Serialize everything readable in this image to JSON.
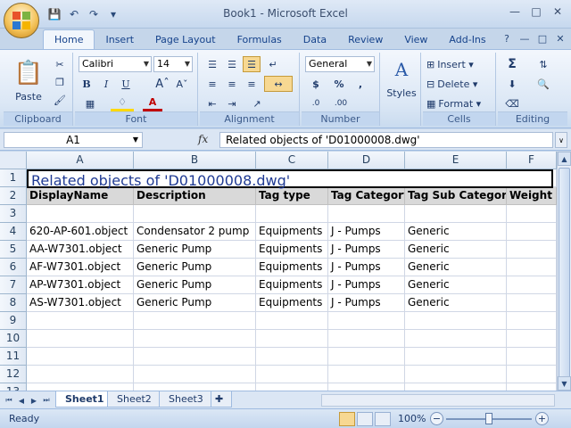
{
  "window": {
    "title": "Book1 - Microsoft Excel"
  },
  "ribbon": {
    "tabs": [
      "Home",
      "Insert",
      "Page Layout",
      "Formulas",
      "Data",
      "Review",
      "View",
      "Add-Ins"
    ],
    "active_tab": "Home",
    "clipboard": {
      "label": "Clipboard",
      "paste_label": "Paste"
    },
    "font": {
      "label": "Font",
      "family": "Calibri",
      "size": "14"
    },
    "alignment": {
      "label": "Alignment"
    },
    "number": {
      "label": "Number",
      "format": "General"
    },
    "styles": {
      "label": "Styles"
    },
    "cells": {
      "label": "Cells",
      "insert_label": "Insert",
      "delete_label": "Delete",
      "format_label": "Format"
    },
    "editing": {
      "label": "Editing"
    }
  },
  "formula_bar": {
    "name_box": "A1",
    "fx": "fx",
    "content": "Related objects of 'D01000008.dwg'"
  },
  "sheet": {
    "columns": [
      "A",
      "B",
      "C",
      "D",
      "E",
      "F"
    ],
    "title_cell": "Related objects of 'D01000008.dwg'",
    "headers": [
      "DisplayName",
      "Description",
      "Tag type",
      "Tag Category",
      "Tag Sub Category",
      "Weight"
    ],
    "data_rows": [
      [
        "620-AP-601.object",
        "Condensator 2 pump",
        "Equipments",
        "J - Pumps",
        "Generic",
        ""
      ],
      [
        "AA-W7301.object",
        "Generic Pump",
        "Equipments",
        "J - Pumps",
        "Generic",
        ""
      ],
      [
        "AF-W7301.object",
        "Generic Pump",
        "Equipments",
        "J - Pumps",
        "Generic",
        ""
      ],
      [
        "AP-W7301.object",
        "Generic Pump",
        "Equipments",
        "J - Pumps",
        "Generic",
        ""
      ],
      [
        "AS-W7301.object",
        "Generic Pump",
        "Equipments",
        "J - Pumps",
        "Generic",
        ""
      ]
    ],
    "row_numbers": [
      "1",
      "2",
      "3",
      "4",
      "5",
      "6",
      "7",
      "8",
      "9",
      "10",
      "11",
      "12",
      "13"
    ]
  },
  "sheet_tabs": [
    "Sheet1",
    "Sheet2",
    "Sheet3"
  ],
  "active_sheet": "Sheet1",
  "status_bar": {
    "status": "Ready",
    "zoom": "100%",
    "zoom_level": 0.5
  },
  "colors": {
    "title_text": "#1f3a93",
    "header_fill": "#d9d9d9",
    "ribbon_text": "#15428b"
  }
}
